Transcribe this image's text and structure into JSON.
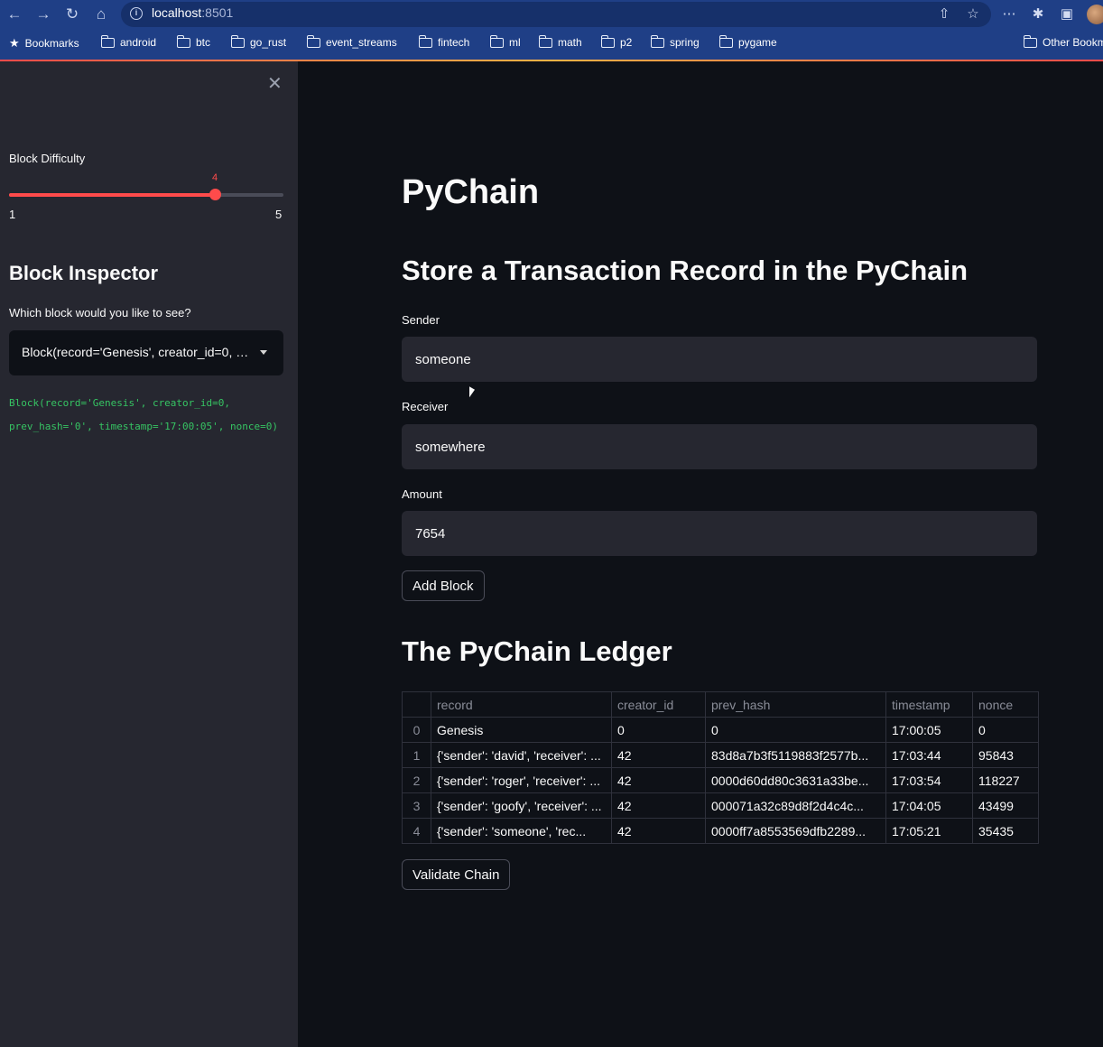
{
  "browser": {
    "url_host": "localhost",
    "url_port": ":8501",
    "bookmarks": [
      "Bookmarks",
      "android",
      "btc",
      "go_rust",
      "event_streams",
      "fintech",
      "ml",
      "math",
      "p2",
      "spring",
      "pygame",
      "Other Bookmarks"
    ]
  },
  "sidebar": {
    "slider": {
      "label": "Block Difficulty",
      "value": 4,
      "min": 1,
      "max": 5,
      "value_label": "4",
      "min_label": "1",
      "max_label": "5"
    },
    "heading": "Block Inspector",
    "select": {
      "label": "Which block would you like to see?",
      "value": "Block(record='Genesis', creator_id=0, prev_hash='0', timestamp='17:00:05', nonce=0)"
    },
    "code": "Block(record='Genesis', creator_id=0, prev_hash='0', timestamp='17:00:05', nonce=0)"
  },
  "main": {
    "title": "PyChain",
    "form_heading": "Store a Transaction Record in the PyChain",
    "sender": {
      "label": "Sender",
      "value": "someone"
    },
    "receiver": {
      "label": "Receiver",
      "value": "somewhere"
    },
    "amount": {
      "label": "Amount",
      "value": "7654"
    },
    "add_button": "Add Block",
    "ledger_heading": "The PyChain Ledger",
    "ledger": {
      "columns": [
        "",
        "record",
        "creator_id",
        "prev_hash",
        "timestamp",
        "nonce"
      ],
      "rows": [
        [
          "0",
          "Genesis",
          "0",
          "0",
          "17:00:05",
          "0"
        ],
        [
          "1",
          "{'sender': 'david', 'receiver': ...",
          "42",
          "83d8a7b3f5119883f2577b...",
          "17:03:44",
          "95843"
        ],
        [
          "2",
          "{'sender': 'roger', 'receiver': ...",
          "42",
          "0000d60dd80c3631a33be...",
          "17:03:54",
          "118227"
        ],
        [
          "3",
          "{'sender': 'goofy', 'receiver': ...",
          "42",
          "000071a32c89d8f2d4c4c...",
          "17:04:05",
          "43499"
        ],
        [
          "4",
          "{'sender': 'someone', 'rec...",
          "42",
          "0000ff7a8553569dfb2289...",
          "17:05:21",
          "35435"
        ]
      ]
    },
    "validate_button": "Validate Chain"
  }
}
